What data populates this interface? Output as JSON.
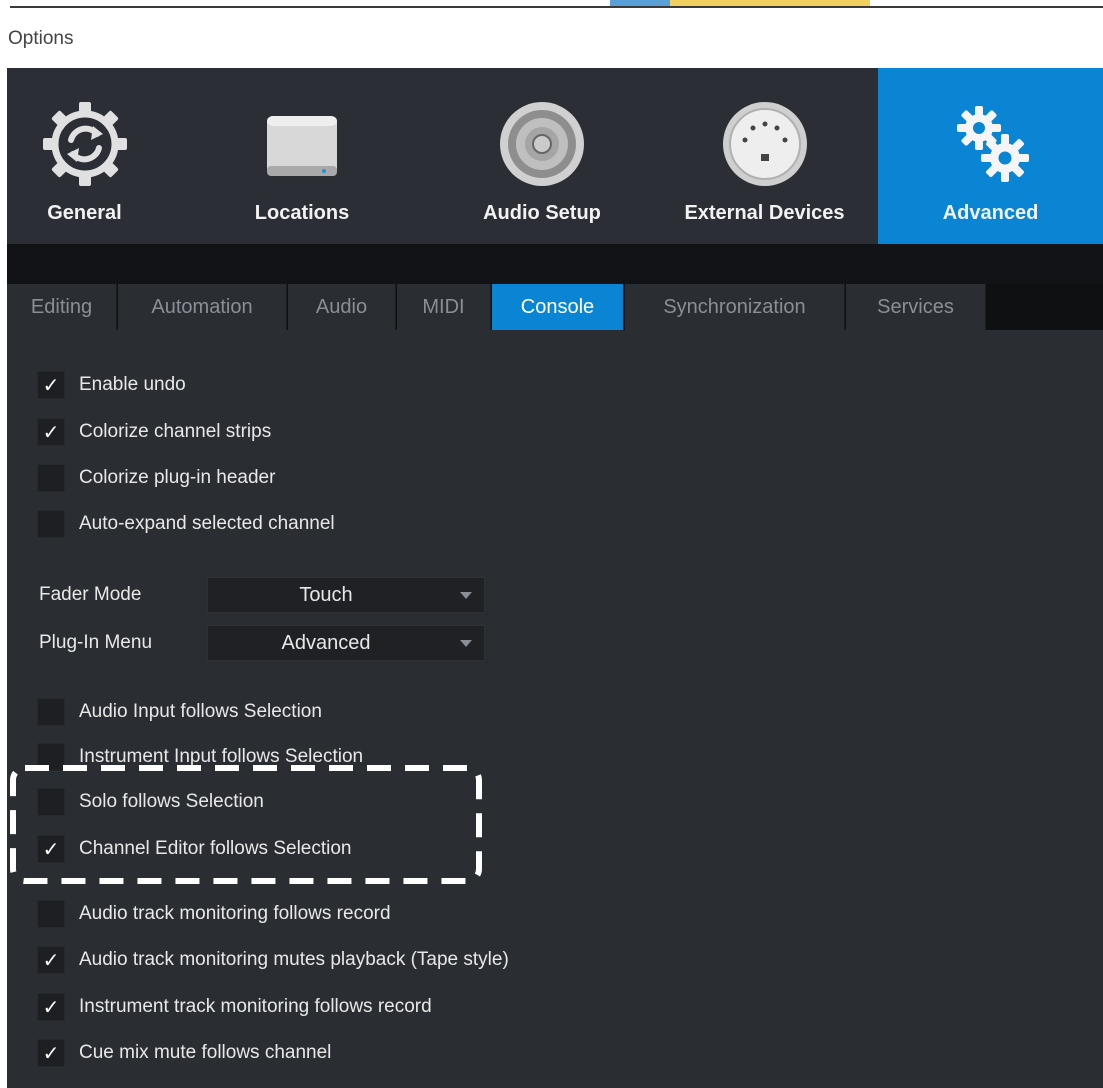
{
  "window": {
    "title": "Options"
  },
  "categories": [
    {
      "label": "General",
      "icon": "gear-sync-icon",
      "active": false
    },
    {
      "label": "Locations",
      "icon": "drive-icon",
      "active": false
    },
    {
      "label": "Audio Setup",
      "icon": "speaker-icon",
      "active": false
    },
    {
      "label": "External Devices",
      "icon": "midi-port-icon",
      "active": false
    },
    {
      "label": "Advanced",
      "icon": "gears-icon",
      "active": true
    }
  ],
  "tabs": [
    {
      "label": "Editing",
      "active": false
    },
    {
      "label": "Automation",
      "active": false
    },
    {
      "label": "Audio",
      "active": false
    },
    {
      "label": "MIDI",
      "active": false
    },
    {
      "label": "Console",
      "active": true
    },
    {
      "label": "Synchronization",
      "active": false
    },
    {
      "label": "Services",
      "active": false
    }
  ],
  "options_group1": [
    {
      "label": "Enable undo",
      "checked": true
    },
    {
      "label": "Colorize channel strips",
      "checked": true
    },
    {
      "label": "Colorize plug-in header",
      "checked": false
    },
    {
      "label": "Auto-expand selected channel",
      "checked": false
    }
  ],
  "fader_mode": {
    "label": "Fader Mode",
    "value": "Touch"
  },
  "plugin_menu": {
    "label": "Plug-In Menu",
    "value": "Advanced"
  },
  "options_group2": [
    {
      "label": "Audio Input follows Selection",
      "checked": false
    },
    {
      "label": "Instrument Input follows Selection",
      "checked": false
    },
    {
      "label": "Solo follows Selection",
      "checked": false
    },
    {
      "label": "Channel Editor follows Selection",
      "checked": true
    },
    {
      "label": "Audio track monitoring follows record",
      "checked": false
    },
    {
      "label": "Audio track monitoring mutes playback (Tape style)",
      "checked": true
    },
    {
      "label": "Instrument track monitoring follows record",
      "checked": true
    },
    {
      "label": "Cue mix mute follows channel",
      "checked": true
    }
  ],
  "checkmark_glyph": "✓",
  "colors": {
    "accent": "#0a85d4",
    "background": "#2a2d32",
    "header": "#2b2e34"
  }
}
